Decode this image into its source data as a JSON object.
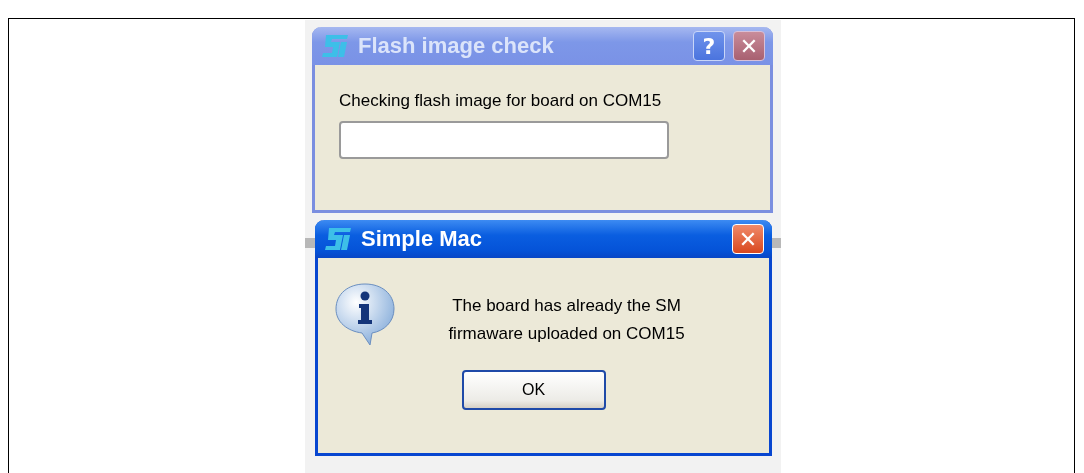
{
  "windows": [
    {
      "kind": "progress",
      "active": false,
      "title": "Flash image check",
      "title_buttons": [
        {
          "kind": "help",
          "label": "?"
        },
        {
          "kind": "close",
          "label": "✕"
        }
      ],
      "message": "Checking flash image for board on COM15",
      "progress": {
        "level": 0
      }
    },
    {
      "kind": "message",
      "active": true,
      "title": "Simple Mac",
      "title_buttons": [
        {
          "kind": "close",
          "label": "✕"
        }
      ],
      "message_lines": [
        "The board has already the SM",
        "firmaware uploaded on COM15"
      ],
      "buttons": [
        "OK"
      ]
    }
  ]
}
